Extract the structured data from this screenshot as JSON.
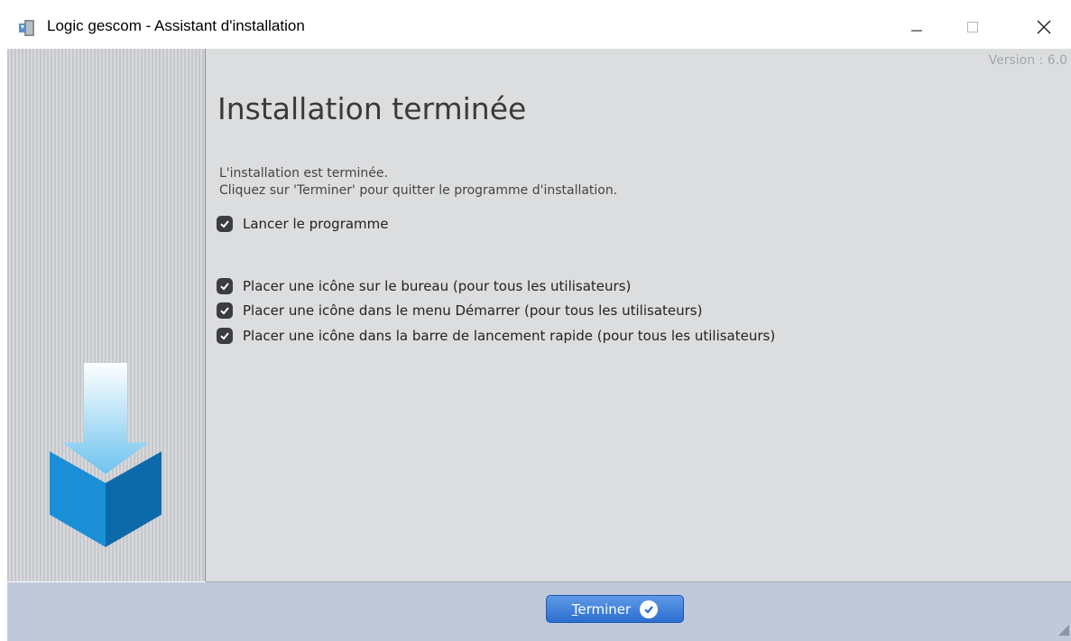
{
  "window": {
    "title": "Logic gescom - Assistant d'installation",
    "icons": {
      "app": "installer-app-icon",
      "minimize": "minimize-icon",
      "maximize": "maximize-icon",
      "close": "close-icon"
    }
  },
  "sidebar": {
    "graphic": "download-box-icon"
  },
  "content": {
    "version": "Version : 6.0",
    "heading": "Installation terminée",
    "description_line1": "L'installation est terminée.",
    "description_line2": "Cliquez sur 'Terminer' pour quitter le programme d'installation.",
    "options": [
      {
        "label": "Lancer le programme",
        "checked": true
      },
      {
        "label": "Placer une icône sur le bureau (pour tous les utilisateurs)",
        "checked": true
      },
      {
        "label": "Placer une icône dans le menu Démarrer (pour tous les utilisateurs)",
        "checked": true
      },
      {
        "label": "Placer une icône dans la barre de lancement rapide (pour tous les utilisateurs)",
        "checked": true
      }
    ]
  },
  "footer": {
    "finish_label": "Terminer",
    "finish_icon": "check-circle-icon"
  },
  "colors": {
    "sidebar_stripe_dark": "#c5c7cb",
    "sidebar_stripe_light": "#d7d9dc",
    "content_bg": "#dcdddf",
    "footer_bg": "#c0c9da",
    "button_blue": "#2c6ed1",
    "checkbox": "#3b3d40",
    "box_blue": "#1a8fd6"
  }
}
